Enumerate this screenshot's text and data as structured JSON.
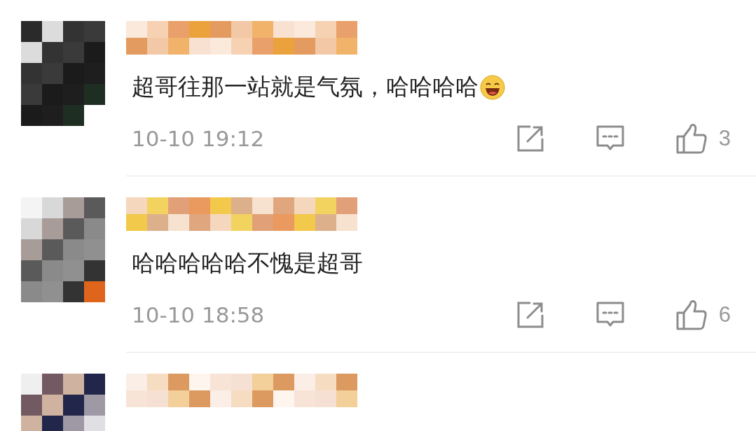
{
  "comments": [
    {
      "text": "超哥往那一站就是气氛，哈哈哈哈",
      "emoji": true,
      "time": "10-10 19:12",
      "likes": "3"
    },
    {
      "text": "哈哈哈哈哈不愧是超哥",
      "emoji": false,
      "time": "10-10 18:58",
      "likes": "6"
    },
    {
      "partial": true
    }
  ]
}
